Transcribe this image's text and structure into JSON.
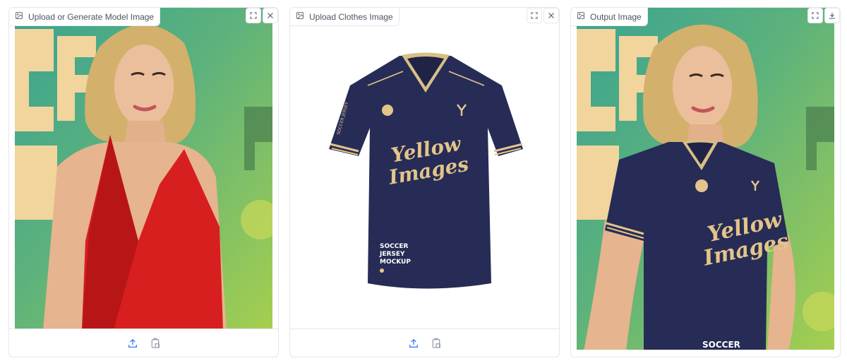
{
  "panels": {
    "model": {
      "label": "Upload or Generate Model Image",
      "icon": "image-icon",
      "tools": [
        "fullscreen-icon",
        "close-icon"
      ],
      "footer": [
        "upload-icon",
        "clipboard-icon"
      ]
    },
    "clothes": {
      "label": "Upload Clothes Image",
      "icon": "image-icon",
      "tools": [
        "fullscreen-icon",
        "close-icon"
      ],
      "footer": [
        "upload-icon",
        "clipboard-icon"
      ],
      "jersey": {
        "brand_line1": "Yellow",
        "brand_line2": "Images",
        "mockup_line1": "SOCCER",
        "mockup_line2": "JERSEY",
        "mockup_line3": "MOCKUP",
        "sleeve_text": "SOCCER JERSEY"
      }
    },
    "output": {
      "label": "Output Image",
      "icon": "image-icon",
      "tools": [
        "fullscreen-icon",
        "download-icon"
      ],
      "jersey": {
        "brand_line1": "Yellow",
        "brand_line2": "Images",
        "bottom_text": "SOCCER"
      }
    }
  },
  "colors": {
    "navy": "#232a50",
    "gold": "#e3c48a",
    "red_dress": "#d41f1f",
    "bg_green": "#7fc05a",
    "bg_teal": "#2f9b8f",
    "cream": "#f0d4a0",
    "skin": "#e8b896",
    "hair": "#d9b87a"
  }
}
